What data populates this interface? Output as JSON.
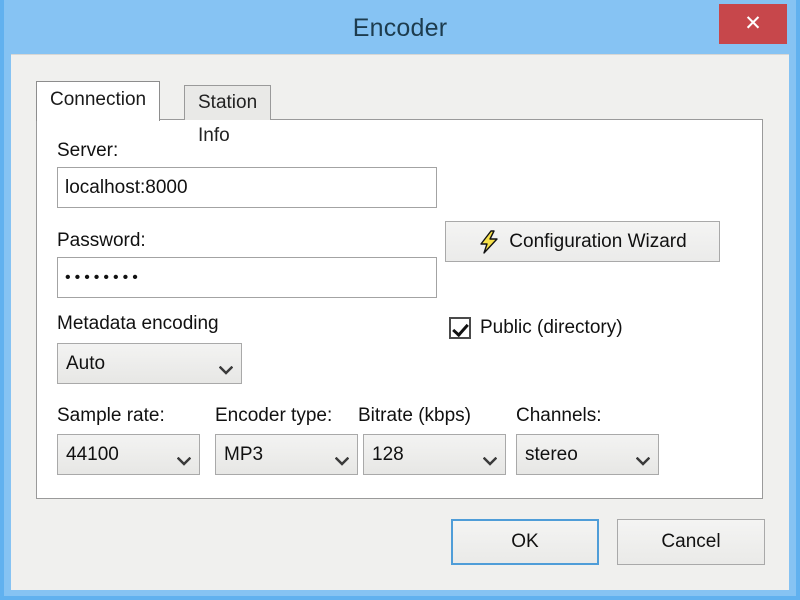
{
  "window": {
    "title": "Encoder",
    "close_label": "✕",
    "close_icon": "close-icon",
    "frame_color": "#86c3f3",
    "titlebar_text_color": "#1d3c4e",
    "close_button_color": "#c7474b",
    "body_color": "#f0f0ee"
  },
  "tabs": [
    {
      "label": "Connection",
      "active": true
    },
    {
      "label": "Station Info",
      "active": false
    }
  ],
  "form": {
    "server": {
      "label": "Server:",
      "value": "localhost:8000",
      "placeholder": ""
    },
    "wizard_button": {
      "label": "Configuration Wizard",
      "icon": "lightning-bolt-icon",
      "icon_color": "#f7e14a"
    },
    "password": {
      "label": "Password:",
      "value": "••••••••",
      "masked_length": 8,
      "placeholder": ""
    },
    "public_checkbox": {
      "label": "Public (directory)",
      "checked": true
    },
    "metadata_encoding": {
      "label": "Metadata encoding",
      "value": "Auto",
      "options": [
        "Auto"
      ]
    },
    "sample_rate": {
      "label": "Sample rate:",
      "value": "44100",
      "options": [
        "44100"
      ]
    },
    "encoder_type": {
      "label": "Encoder type:",
      "value": "MP3",
      "options": [
        "MP3"
      ]
    },
    "bitrate": {
      "label": "Bitrate (kbps)",
      "value": "128",
      "options": [
        "128"
      ]
    },
    "channels": {
      "label": "Channels:",
      "value": "stereo",
      "options": [
        "stereo"
      ]
    }
  },
  "footer": {
    "ok_label": "OK",
    "cancel_label": "Cancel",
    "ok_focus_color": "#4f9dd8"
  }
}
